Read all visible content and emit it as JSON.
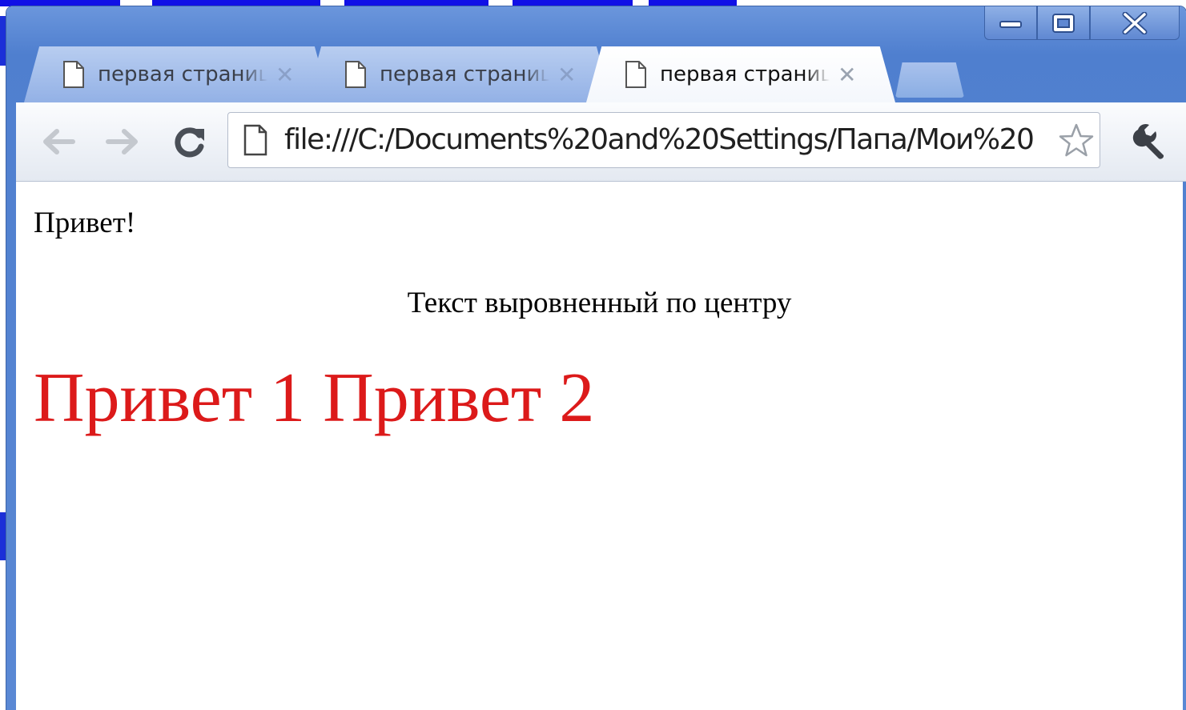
{
  "window": {
    "controls": [
      {
        "name": "minimize",
        "icon": "minimize-icon"
      },
      {
        "name": "maximize",
        "icon": "maximize-icon"
      },
      {
        "name": "close",
        "icon": "close-icon"
      }
    ]
  },
  "tabs": [
    {
      "label": "первая страница",
      "active": false,
      "icon": "document-icon",
      "close_glyph": "✕"
    },
    {
      "label": "первая страница",
      "active": false,
      "icon": "document-icon",
      "close_glyph": "✕"
    },
    {
      "label": "первая страница",
      "active": true,
      "icon": "document-icon",
      "close_glyph": "✕"
    }
  ],
  "toolbar": {
    "back_icon": "back-arrow-icon",
    "forward_icon": "forward-arrow-icon",
    "reload_icon": "reload-icon",
    "url": "file:///C:/Documents%20and%20Settings/Папа/Мои%20",
    "bookmark_icon": "star-icon",
    "menu_icon": "wrench-icon"
  },
  "page": {
    "greeting": "Привет!",
    "centered_text": "Текст выровненный по центру",
    "red_text": "Привет 1 Привет 2",
    "red_color": "#dc1a1a"
  },
  "colors": {
    "frame": "#4f7fcf",
    "slide_title_accent": "#1010e6"
  }
}
